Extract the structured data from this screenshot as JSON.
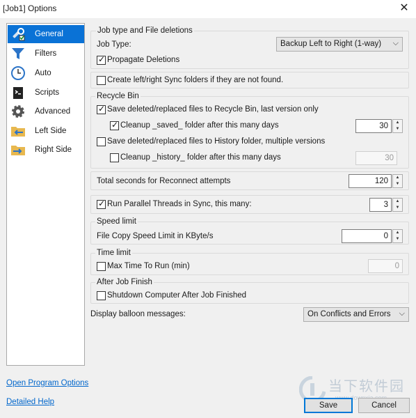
{
  "window": {
    "title": "[Job1] Options",
    "close_glyph": "✕"
  },
  "nav": [
    {
      "label": "General",
      "icon": "tools-icon",
      "selected": true
    },
    {
      "label": "Filters",
      "icon": "funnel-icon"
    },
    {
      "label": "Auto",
      "icon": "clock-icon"
    },
    {
      "label": "Scripts",
      "icon": "script-icon"
    },
    {
      "label": "Advanced",
      "icon": "gear-icon"
    },
    {
      "label": "Left Side",
      "icon": "folder-left-icon"
    },
    {
      "label": "Right Side",
      "icon": "folder-right-icon"
    }
  ],
  "job": {
    "group_label": "Job type and File deletions",
    "type_label": "Job Type:",
    "type_value": "Backup Left to Right (1-way)",
    "propagate_label": "Propagate Deletions",
    "propagate_checked": true
  },
  "create_folders": {
    "label": "Create left/right Sync folders if they are not found.",
    "checked": false
  },
  "recycle": {
    "group_label": "Recycle Bin",
    "save_recycle_label": "Save deleted/replaced files to Recycle Bin, last version only",
    "save_recycle_checked": true,
    "cleanup_saved_label": "Cleanup _saved_ folder after this many days",
    "cleanup_saved_checked": true,
    "cleanup_saved_value": "30",
    "save_history_label": "Save deleted/replaced files to History folder, multiple versions",
    "save_history_checked": false,
    "cleanup_history_label": "Cleanup _history_ folder after this many days",
    "cleanup_history_checked": false,
    "cleanup_history_value": "30"
  },
  "reconnect": {
    "label": "Total seconds for Reconnect attempts",
    "value": "120"
  },
  "parallel": {
    "label": "Run Parallel Threads in Sync, this many:",
    "checked": true,
    "value": "3"
  },
  "speed": {
    "group_label": "Speed limit",
    "label": "File Copy Speed Limit in KByte/s",
    "value": "0"
  },
  "time": {
    "group_label": "Time limit",
    "label": "Max Time To Run (min)",
    "checked": false,
    "value": "0"
  },
  "after": {
    "group_label": "After Job Finish",
    "label": "Shutdown Computer After Job Finished",
    "checked": false
  },
  "balloon": {
    "label": "Display balloon messages:",
    "value": "On Conflicts and Errors"
  },
  "links": {
    "open_program_options": "Open Program Options",
    "detailed_help": "Detailed Help"
  },
  "buttons": {
    "save": "Save",
    "cancel": "Cancel"
  },
  "watermark": {
    "text": "当下软件园",
    "url": "www.downxia.com"
  },
  "colors": {
    "selection": "#0a72d6",
    "link": "#0066cc",
    "default_button_border": "#0078d7"
  }
}
